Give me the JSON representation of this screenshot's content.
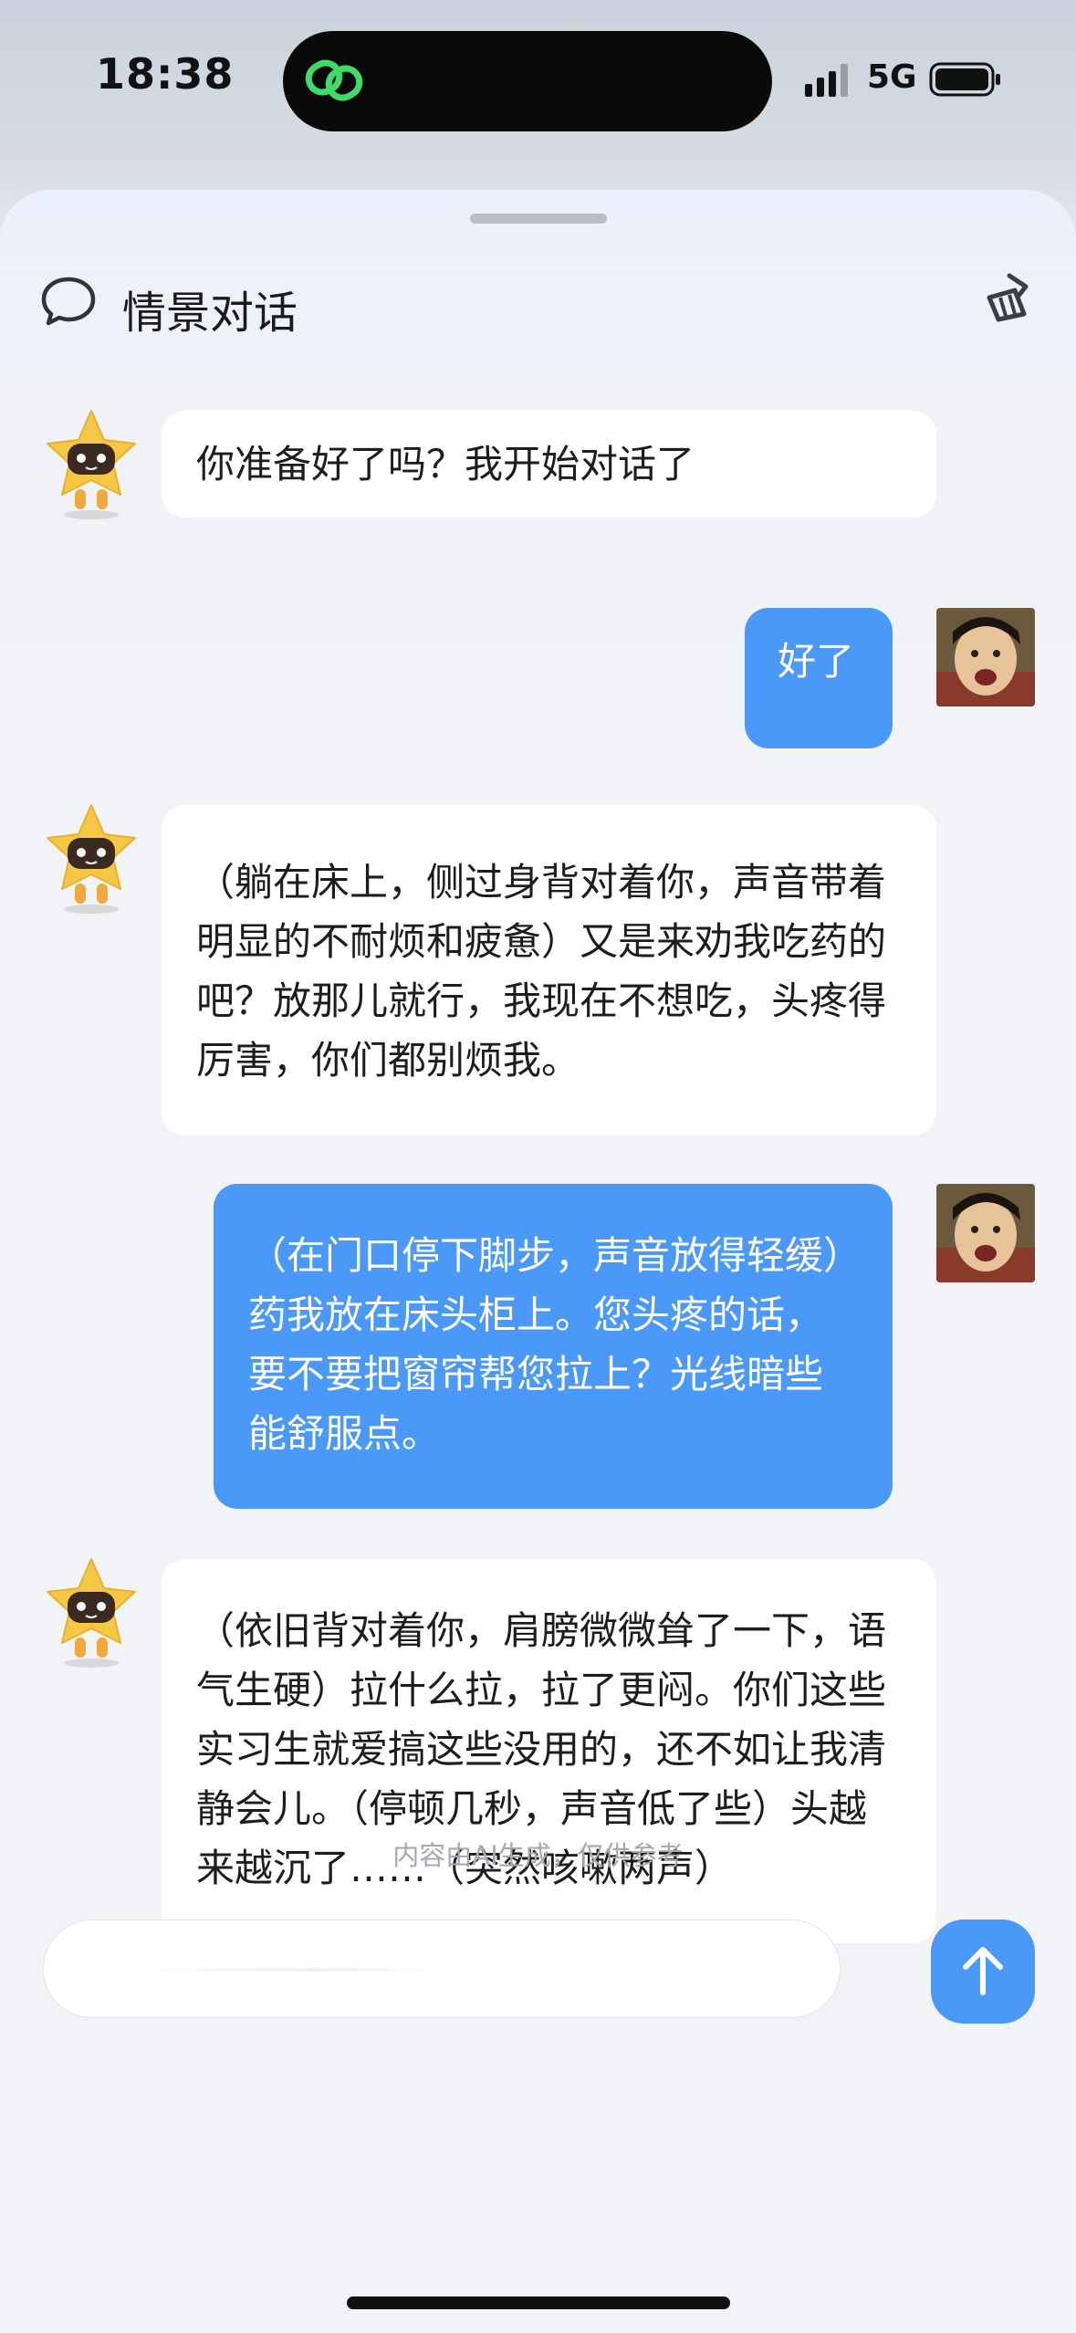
{
  "status_bar": {
    "time": "18:38",
    "network": "5G"
  },
  "header": {
    "title": "情景对话"
  },
  "messages": [
    {
      "role": "ai",
      "text": "你准备好了吗？我开始对话了"
    },
    {
      "role": "user",
      "text": "好了"
    },
    {
      "role": "ai",
      "text": "（躺在床上，侧过身背对着你，声音带着明显的不耐烦和疲惫）又是来劝我吃药的吧？放那儿就行，我现在不想吃，头疼得厉害，你们都别烦我。"
    },
    {
      "role": "user",
      "text": "（在门口停下脚步，声音放得轻缓）药我放在床头柜上。您头疼的话，要不要把窗帘帮您拉上？光线暗些能舒服点。"
    },
    {
      "role": "ai",
      "text": "（依旧背对着你，肩膀微微耸了一下，语气生硬）拉什么拉，拉了更闷。你们这些实习生就爱搞这些没用的，还不如让我清静会儿。（停顿几秒，声音低了些）头越来越沉了……（突然咳嗽两声）"
    }
  ],
  "footnote": "内容由AI生成，仅供参考",
  "input": {
    "placeholder": ""
  },
  "icons": {
    "header": "chat-bubble-icon",
    "clear": "broom-icon",
    "send": "arrow-up-icon",
    "app": "link-logo-icon"
  },
  "colors": {
    "accent": "#4a98f7",
    "bot_yellow": "#f6c744"
  }
}
